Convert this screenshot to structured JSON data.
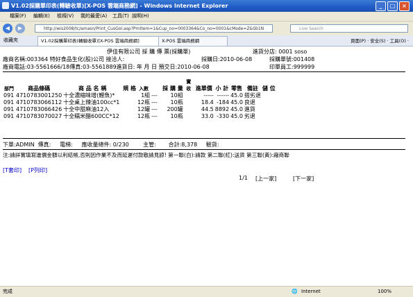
{
  "window": {
    "title": "V1.02採購單印表(轉驗收單)[X-POS 雲端商務網] - Windows Internet Explorer",
    "min": "_",
    "max": "□",
    "close": "×"
  },
  "menu": [
    "檔案(F)",
    "編輯(E)",
    "檢視(V)",
    "我的最愛(A)",
    "工具(T)",
    "說明(H)"
  ],
  "address": {
    "url": "http://wis2008/tc/amasn/Print_CusGoI.asp?PrnItem=1&Cup_no=0003364&Co_no=0001&cMode=Z&Sb1N",
    "search_placeholder": "Live Search"
  },
  "tabs": {
    "favorites": "收藏夾",
    "items": [
      "V1.02採購單印表(轉驗收單)[X-POS 雲端商務網]",
      "X-POS 雲端商務網"
    ],
    "tools": "頁面(P) · 安全(S) · 工具(O) ·"
  },
  "doc": {
    "company": "伊佳有限公司 採 購 傳 票(採購單)",
    "branch": "進貨分店: 0001 soso",
    "vendor": "廠商名稱:003364 特好食品生化(股)公司 接洽人:",
    "purchase_date": "採購日:2010-06-08",
    "po_no": "採購單號:001408",
    "vendor_phone": "廠商電話:03-5561666/18傳真:03-5561889進貨日: 年 月 日 預交日:2010-06-08",
    "printer": "印單員工:999999",
    "headers": [
      "部門",
      "商品條碼",
      "商 品 名 稱",
      "規 格",
      "入數",
      "",
      "採 購 量",
      "實收",
      "進單價",
      "小 計",
      "零售",
      "備註",
      "儲 位"
    ],
    "rows": [
      [
        "091",
        "4710783001250",
        "十全濃縮味增(鯉魚)*",
        "",
        "1組",
        "---",
        "10組",
        "",
        "-----",
        "------",
        "45.0",
        "搭劣退",
        ""
      ],
      [
        "091",
        "4710783066112",
        "十全桌上辣油100cc*1",
        "",
        "12瓶",
        "---",
        "10瓶",
        "",
        "18.4",
        "-184",
        "45.0",
        "良退",
        ""
      ],
      [
        "091",
        "4710783066426",
        "十全中甜麻油12入",
        "",
        "12罐",
        "---",
        "200罐",
        "",
        "44.5",
        "8892",
        "45.0",
        "進貨",
        ""
      ],
      [
        "091",
        "4710783070027",
        "十全糯米醋600CC*12",
        "",
        "12瓶",
        "---",
        "10瓶",
        "",
        "33.0",
        "-330",
        "45.0",
        "劣退",
        ""
      ]
    ],
    "footer1": "下單:ADMIN  傳真:     電梯:     應收量總件: 0/230        主管:       合計:8,378     驗貨:",
    "note": "注:請詳實填寫進價金額以利結帳,否則因作業不及而延遲付款敬請見諒! 第一聯(白):請款 第二聯(紅):送貨 第三聯(黃):廠商聯",
    "links": [
      "[T套印]",
      "[P列印]"
    ],
    "pager": "1/1",
    "prev": "[上一家]",
    "next": "[下一家]"
  },
  "status": {
    "left": "完成",
    "zone": "Internet",
    "zoom": "100%"
  }
}
